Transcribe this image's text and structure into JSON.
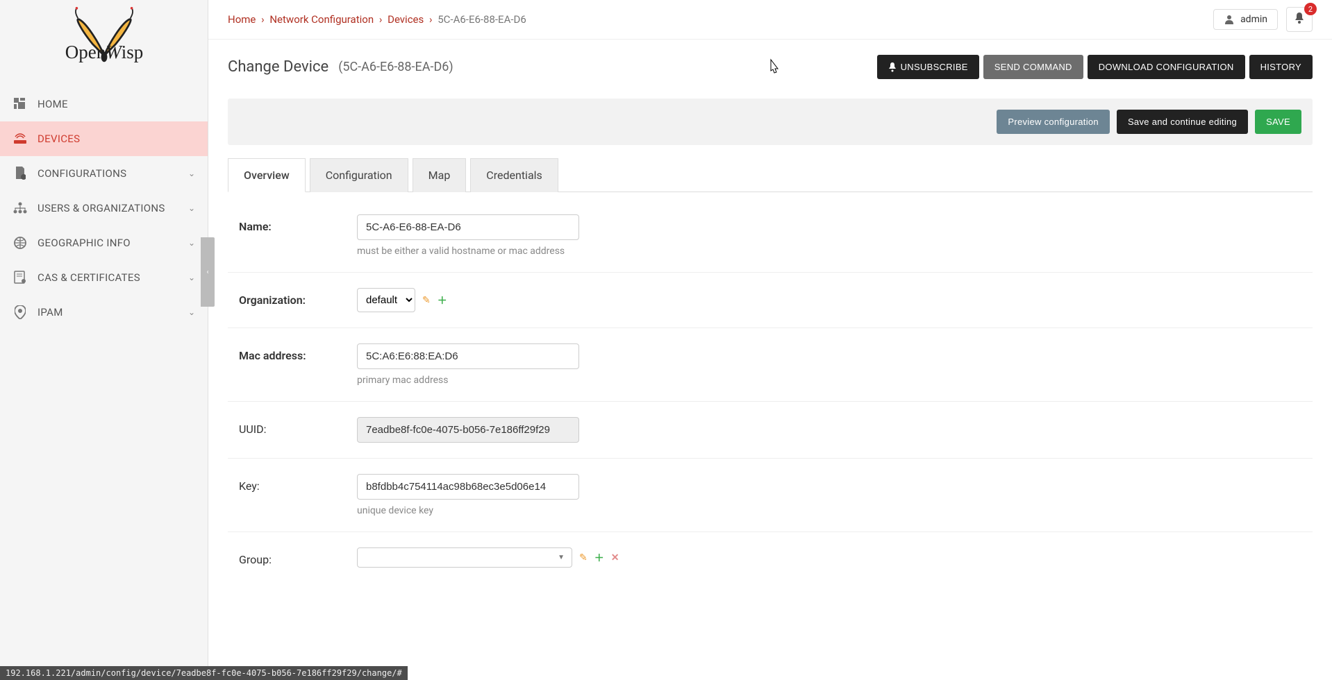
{
  "breadcrumb": {
    "home": "Home",
    "nc": "Network Configuration",
    "devices": "Devices",
    "current": "5C-A6-E6-88-EA-D6"
  },
  "user": "admin",
  "notifications": "2",
  "page": {
    "title": "Change Device",
    "sub": "(5C-A6-E6-88-EA-D6)"
  },
  "buttons": {
    "unsubscribe": "UNSUBSCRIBE",
    "send_command": "SEND COMMAND",
    "download_conf": "DOWNLOAD CONFIGURATION",
    "history": "HISTORY",
    "preview": "Preview configuration",
    "save_continue": "Save and continue editing",
    "save": "SAVE"
  },
  "sidebar": {
    "home": "HOME",
    "devices": "DEVICES",
    "configurations": "CONFIGURATIONS",
    "users_orgs": "USERS & ORGANIZATIONS",
    "geo": "GEOGRAPHIC INFO",
    "cas": "CAS & CERTIFICATES",
    "ipam": "IPAM"
  },
  "tabs": {
    "overview": "Overview",
    "configuration": "Configuration",
    "map": "Map",
    "credentials": "Credentials"
  },
  "fields": {
    "name": {
      "label": "Name:",
      "value": "5C-A6-E6-88-EA-D6",
      "help": "must be either a valid hostname or mac address"
    },
    "organization": {
      "label": "Organization:",
      "value": "default"
    },
    "mac": {
      "label": "Mac address:",
      "value": "5C:A6:E6:88:EA:D6",
      "help": "primary mac address"
    },
    "uuid": {
      "label": "UUID:",
      "value": "7eadbe8f-fc0e-4075-b056-7e186ff29f29"
    },
    "key": {
      "label": "Key:",
      "value": "b8fdbb4c754114ac98b68ec3e5d06e14",
      "help": "unique device key"
    },
    "group": {
      "label": "Group:"
    }
  },
  "status_url": "192.168.1.221/admin/config/device/7eadbe8f-fc0e-4075-b056-7e186ff29f29/change/#"
}
